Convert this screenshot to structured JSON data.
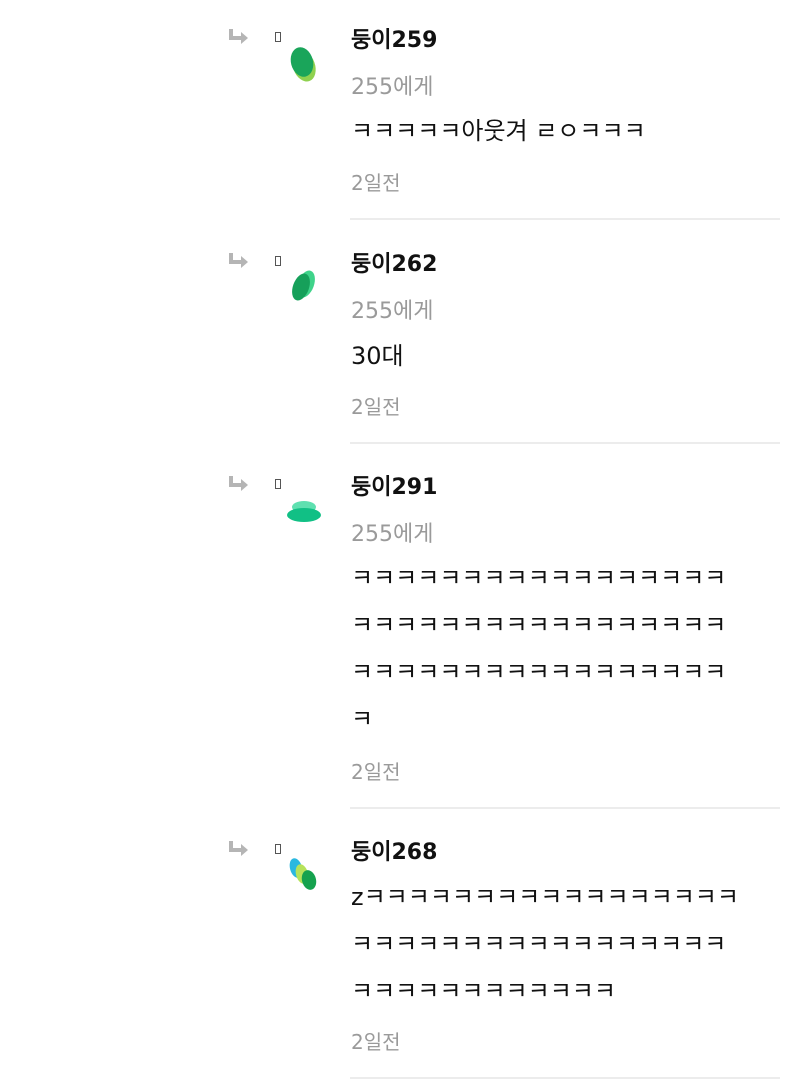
{
  "comments": [
    {
      "nickname": "둥이259",
      "target": "255에게",
      "lines": [
        "ㅋㅋㅋㅋㅋ아웃겨 ㄹㅇㅋㅋㅋ"
      ],
      "time": "2일전",
      "avatar_icon": "green-blob-icon"
    },
    {
      "nickname": "둥이262",
      "target": "255에게",
      "lines": [
        "30대"
      ],
      "time": "2일전",
      "avatar_icon": "green-blob-icon"
    },
    {
      "nickname": "둥이291",
      "target": "255에게",
      "lines": [
        "ㅋㅋㅋㅋㅋㅋㅋㅋㅋㅋㅋㅋㅋㅋㅋㅋㅋ",
        "ㅋㅋㅋㅋㅋㅋㅋㅋㅋㅋㅋㅋㅋㅋㅋㅋㅋ",
        "ㅋㅋㅋㅋㅋㅋㅋㅋㅋㅋㅋㅋㅋㅋㅋㅋㅋ",
        "ㅋ"
      ],
      "time": "2일전",
      "avatar_icon": "teal-blob-icon"
    },
    {
      "nickname": "둥이268",
      "target": "",
      "lines": [
        "zㅋㅋㅋㅋㅋㅋㅋㅋㅋㅋㅋㅋㅋㅋㅋㅋㅋ",
        "ㅋㅋㅋㅋㅋㅋㅋㅋㅋㅋㅋㅋㅋㅋㅋㅋㅋ",
        "ㅋㅋㅋㅋㅋㅋㅋㅋㅋㅋㅋㅋ"
      ],
      "time": "2일전",
      "avatar_icon": "multicolor-blob-icon"
    }
  ],
  "icons": {
    "reply": "reply-arrow-icon"
  },
  "colors": {
    "nickname": "#111111",
    "meta": "#9a9a9a",
    "divider": "#ececec",
    "arrow": "#b5b5b5"
  }
}
